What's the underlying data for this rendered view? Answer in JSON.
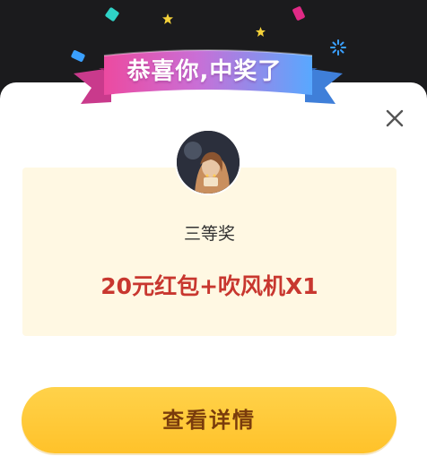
{
  "dialog": {
    "title": "恭喜你,中奖了",
    "close_icon": "close-icon"
  },
  "prize": {
    "avatar_icon": "avatar",
    "tier": "三等奖",
    "name": "20元红包+吹风机X1"
  },
  "actions": {
    "details_label": "查看详情"
  },
  "colors": {
    "backdrop": "#1b1b1d",
    "panel": "#fff8e3",
    "prize_text": "#c8372f",
    "button": "#ffc22a",
    "button_text": "#7a3c0c",
    "ribbon_pink": "#e94ea8",
    "ribbon_blue": "#5aa7ff"
  }
}
